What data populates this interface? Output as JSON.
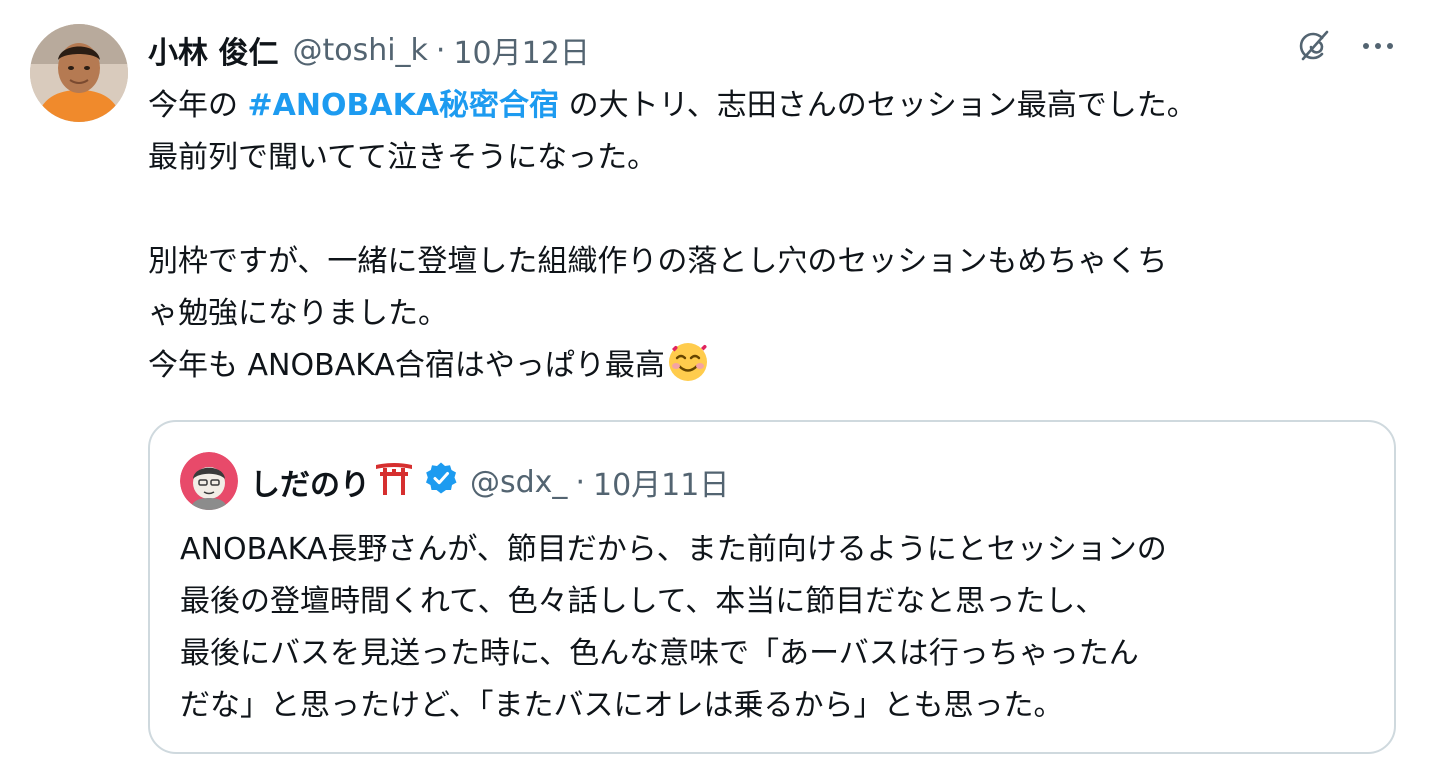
{
  "tweet": {
    "author": {
      "display_name": "小林 俊仁",
      "handle": "@toshi_k",
      "separator": "·",
      "date": "10月12日",
      "avatar": "avatar-photo"
    },
    "actions": {
      "grok_icon": "grok-icon",
      "more_icon": "more-icon"
    },
    "text": {
      "line1_prefix": "今年の ",
      "hashtag": "#ANOBAKA秘密合宿",
      "line1_suffix": " の大トリ、志田さんのセッション最高でした。",
      "line2": "最前列で聞いてて泣きそうになった。",
      "line3": "別枠ですが、一緒に登壇した組織作りの落とし穴のセッションもめちゃくち",
      "line4": "ゃ勉強になりました。",
      "line5": "今年も ANOBAKA合宿はやっぱり最高",
      "emoji": "smiling-face-with-hearts-emoji"
    }
  },
  "quote": {
    "author": {
      "display_name": "しだのり",
      "name_emoji": "torii-gate-emoji",
      "verified": "verified-badge-icon",
      "handle": "@sdx_",
      "separator": "·",
      "date": "10月11日"
    },
    "text": {
      "line1": "ANOBAKA長野さんが、節目だから、また前向けるようにとセッションの",
      "line2": "最後の登壇時間くれて、色々話しして、本当に節目だなと思ったし、",
      "line3": "最後にバスを見送った時に、色んな意味で「あーバスは行っちゃったん",
      "line4": "だな」と思ったけど、「またバスにオレは乗るから」とも思った。"
    }
  },
  "colors": {
    "text": "#0f1419",
    "secondary": "#536471",
    "link": "#1d9bf0",
    "border": "#cfd9de",
    "verified": "#1d9bf0"
  }
}
